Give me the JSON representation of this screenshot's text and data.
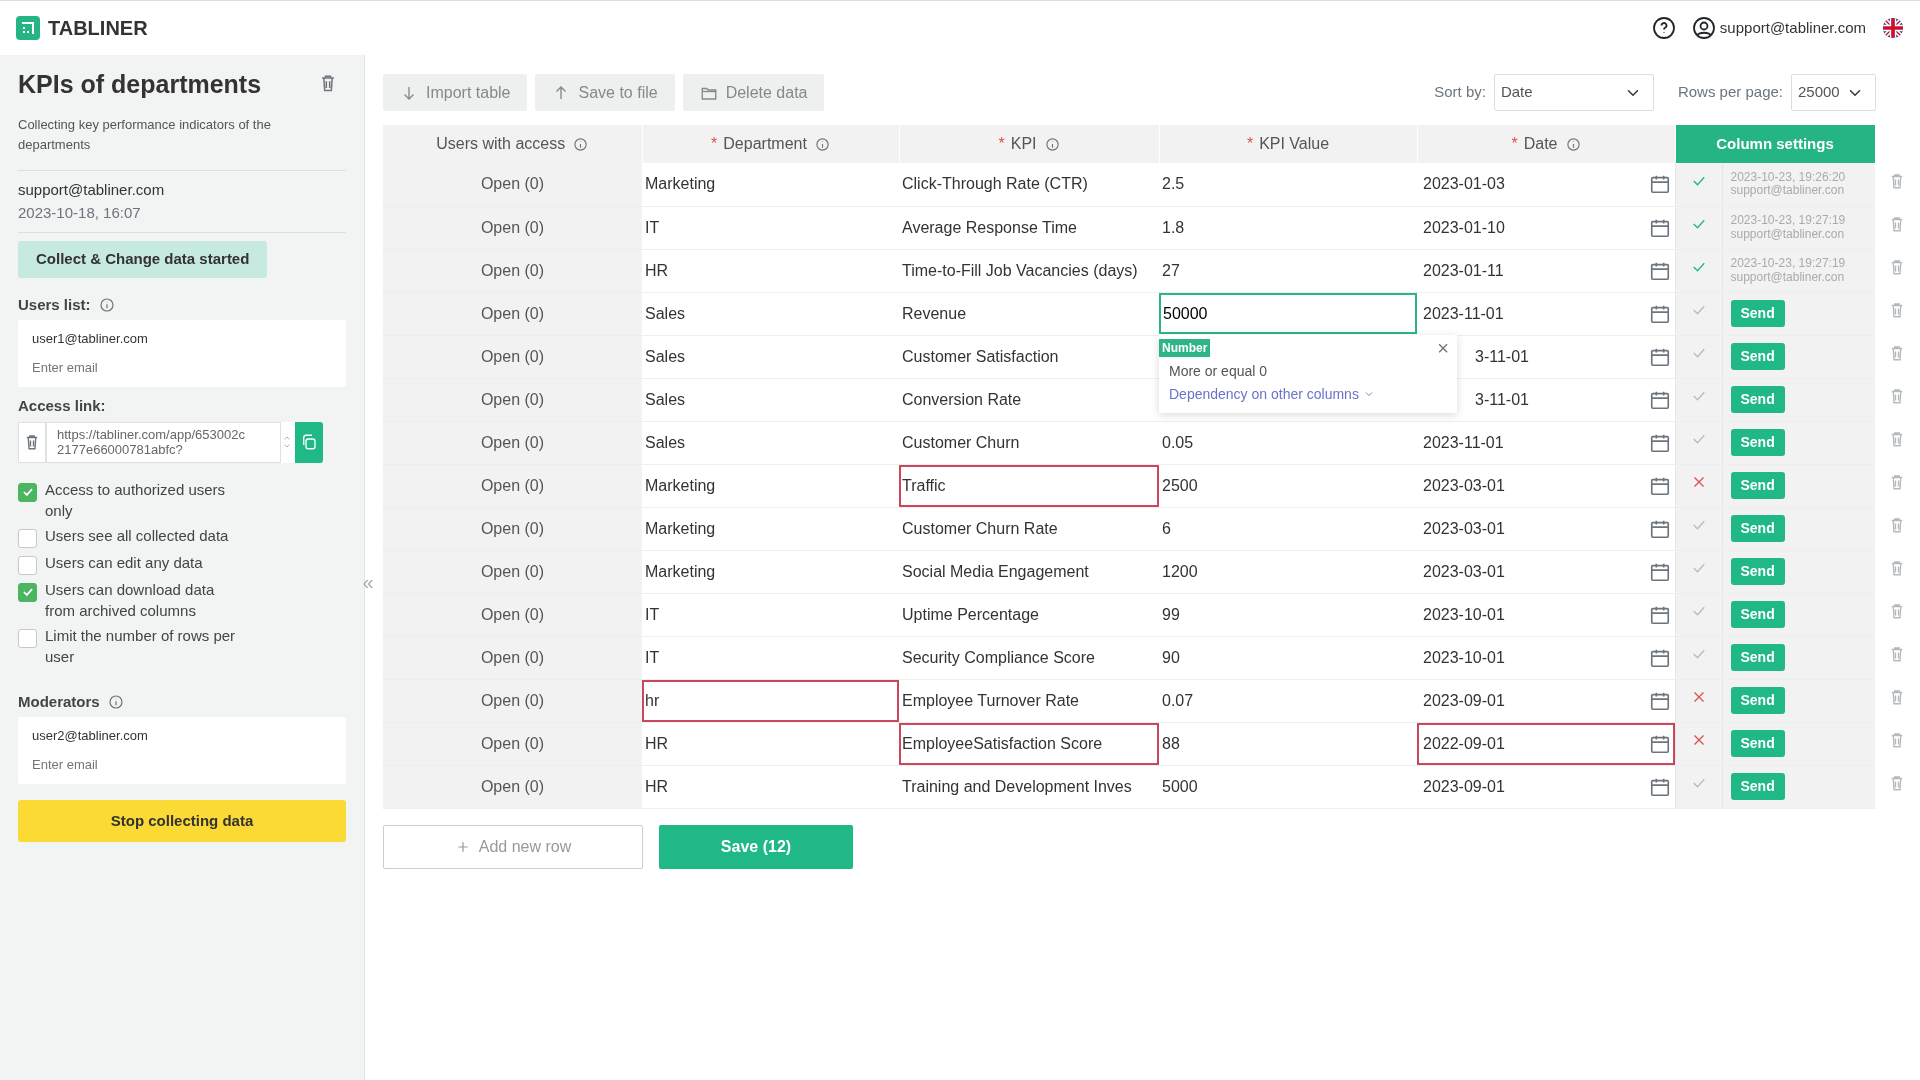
{
  "header": {
    "brand": "TABLINER",
    "user": "support@tabliner.com"
  },
  "sidebar": {
    "title": "KPIs of departments",
    "description": "Collecting key performance indicators of the departments",
    "author": "support@tabliner.com",
    "created": "2023-10-18, 16:07",
    "status": "Collect & Change data started",
    "users_label": "Users list:",
    "users": [
      "user1@tabliner.com"
    ],
    "users_placeholder": "Enter email",
    "link_label": "Access link:",
    "link": "https://tabliner.com/app/653002c2177e66000781abfc?",
    "options": [
      {
        "label": "Access to authorized users only",
        "checked": true
      },
      {
        "label": "Users see all collected data",
        "checked": false
      },
      {
        "label": "Users can edit any data",
        "checked": false
      },
      {
        "label": "Users can download data from archived columns",
        "checked": true
      },
      {
        "label": "Limit the number of rows per user",
        "checked": false
      }
    ],
    "moderators_label": "Moderators",
    "moderators": [
      "user2@tabliner.com"
    ],
    "moderators_placeholder": "Enter email",
    "stop_button": "Stop collecting data",
    "collapse": "«"
  },
  "toolbar": {
    "buttons": [
      "Import table",
      "Save to file",
      "Delete data"
    ],
    "sort_label": "Sort by:",
    "sort_value": "Date",
    "rows_label": "Rows per page:",
    "rows_value": "25000"
  },
  "table": {
    "columns": [
      {
        "label": "Users with access",
        "info": true
      },
      {
        "label": "Department",
        "required_mark": "*",
        "info": true
      },
      {
        "label": "KPI",
        "required_mark": "*",
        "info": true
      },
      {
        "label": "KPI Value",
        "required_mark": "*",
        "info": false
      },
      {
        "label": "Date",
        "required_mark": "*",
        "info": true
      }
    ],
    "settings": "Column settings",
    "rows": [
      {
        "access": "Open (0)",
        "department": "Marketing",
        "kpi": "Click-Through Rate (CTR)",
        "value": "2.5",
        "date": "2023-01-03",
        "kind": "saved",
        "saved_at": "2023-10-23, 19:26:20",
        "saved_by": "support@tabliner.con",
        "department_invalid": false,
        "kpi_invalid": false,
        "date_invalid": false
      },
      {
        "access": "Open (0)",
        "department": "IT",
        "kpi": "Average Response Time",
        "value": "1.8",
        "date": "2023-01-10",
        "kind": "saved",
        "saved_at": "2023-10-23, 19:27:19",
        "saved_by": "support@tabliner.con",
        "department_invalid": false,
        "kpi_invalid": false,
        "date_invalid": false
      },
      {
        "access": "Open (0)",
        "department": "HR",
        "kpi": "Time-to-Fill Job Vacancies (days)",
        "value": "27",
        "date": "2023-01-11",
        "kind": "saved",
        "saved_at": "2023-10-23, 19:27:19",
        "saved_by": "support@tabliner.con",
        "department_invalid": false,
        "kpi_invalid": false,
        "date_invalid": false
      },
      {
        "access": "Open (0)",
        "department": "Sales",
        "kpi": "Revenue",
        "value": "50000",
        "editing": true,
        "date": "2023-11-01",
        "kind": "pending",
        "send": "Send",
        "department_invalid": false,
        "kpi_invalid": false,
        "date_invalid": false
      },
      {
        "access": "Open (0)",
        "department": "Sales",
        "kpi": "Customer Satisfaction",
        "date": "3-11-01",
        "kind": "pending",
        "send": "Send",
        "department_invalid": false,
        "kpi_invalid": false,
        "date_invalid": false
      },
      {
        "access": "Open (0)",
        "department": "Sales",
        "kpi": "Conversion Rate",
        "date": "3-11-01",
        "kind": "pending",
        "send": "Send",
        "department_invalid": false,
        "kpi_invalid": false,
        "date_invalid": false
      },
      {
        "access": "Open (0)",
        "department": "Sales",
        "kpi": "Customer Churn",
        "value": "0.05",
        "date": "2023-11-01",
        "kind": "pending",
        "send": "Send",
        "department_invalid": false,
        "kpi_invalid": false,
        "date_invalid": false
      },
      {
        "access": "Open (0)",
        "department": "Marketing",
        "kpi": "Traffic",
        "value": "2500",
        "date": "2023-03-01",
        "kind": "error",
        "send": "Send",
        "department_invalid": false,
        "kpi_invalid": true,
        "date_invalid": false
      },
      {
        "access": "Open (0)",
        "department": "Marketing",
        "kpi": "Customer Churn Rate",
        "value": "6",
        "date": "2023-03-01",
        "kind": "pending",
        "send": "Send",
        "department_invalid": false,
        "kpi_invalid": false,
        "date_invalid": false
      },
      {
        "access": "Open (0)",
        "department": "Marketing",
        "kpi": "Social Media Engagement",
        "value": "1200",
        "date": "2023-03-01",
        "kind": "pending",
        "send": "Send",
        "department_invalid": false,
        "kpi_invalid": false,
        "date_invalid": false
      },
      {
        "access": "Open (0)",
        "department": "IT",
        "kpi": "Uptime Percentage",
        "value": "99",
        "date": "2023-10-01",
        "kind": "pending",
        "send": "Send",
        "department_invalid": false,
        "kpi_invalid": false,
        "date_invalid": false
      },
      {
        "access": "Open (0)",
        "department": "IT",
        "kpi": "Security Compliance Score",
        "value": "90",
        "date": "2023-10-01",
        "kind": "pending",
        "send": "Send",
        "department_invalid": false,
        "kpi_invalid": false,
        "date_invalid": false
      },
      {
        "access": "Open (0)",
        "department": "hr",
        "kpi": "Employee Turnover Rate",
        "value": "0.07",
        "date": "2023-09-01",
        "kind": "error",
        "send": "Send",
        "department_invalid": true,
        "kpi_invalid": false,
        "date_invalid": false
      },
      {
        "access": "Open (0)",
        "department": "HR",
        "kpi": "EmployeeSatisfaction Score",
        "value": "88",
        "date": "2022-09-01",
        "kind": "error",
        "send": "Send",
        "department_invalid": false,
        "kpi_invalid": true,
        "date_invalid": true
      },
      {
        "access": "Open (0)",
        "department": "HR",
        "kpi": "Training and Development Inves",
        "value": "5000",
        "date": "2023-09-01",
        "kind": "pending",
        "send": "Send",
        "department_invalid": false,
        "kpi_invalid": false,
        "date_invalid": false
      }
    ]
  },
  "popup": {
    "tag": "Number",
    "rule": "More or equal 0",
    "link": "Dependency on other columns",
    "close": "×"
  },
  "footer": {
    "add": "Add new row",
    "save": "Save (12)"
  }
}
